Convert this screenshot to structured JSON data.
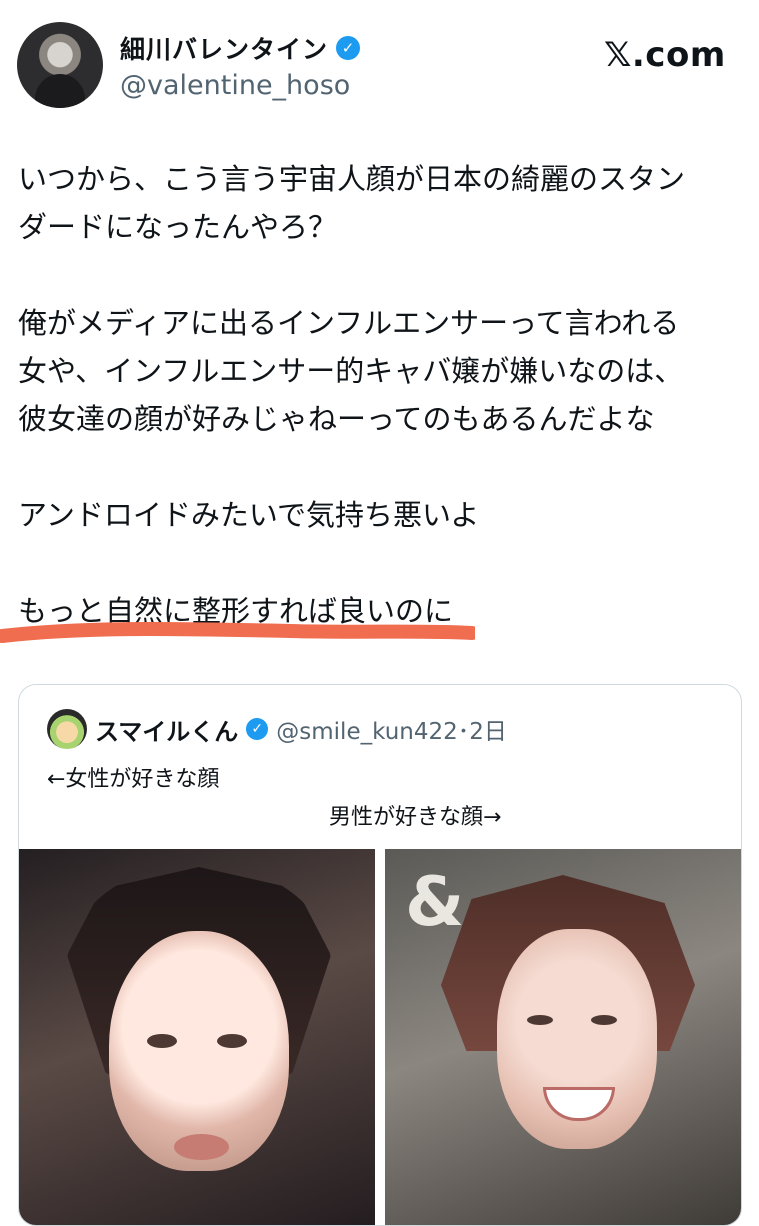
{
  "header": {
    "display_name": "細川バレンタイン",
    "handle": "@valentine_hoso",
    "brand": "𝕏.com"
  },
  "tweet": {
    "lines": [
      "いつから、こう言う宇宙人顔が日本の綺麗のスタン",
      "ダードになったんやろ？",
      "",
      "俺がメディアに出るインフルエンサーって言われる",
      "女や、インフルエンサー的キャバ嬢が嫌いなのは、",
      "彼女達の顔が好みじゃねーってのもあるんだよな",
      "",
      "アンドロイドみたいで気持ち悪いよ",
      "",
      "もっと自然に整形すれば良いのに"
    ],
    "accent": "#f06d4f"
  },
  "quote": {
    "name": "スマイルくん",
    "handle_time": "@smile_kun422･2日",
    "line1": "←女性が好きな顔",
    "line2": "男性が好きな顔→",
    "logo_text": "&"
  }
}
